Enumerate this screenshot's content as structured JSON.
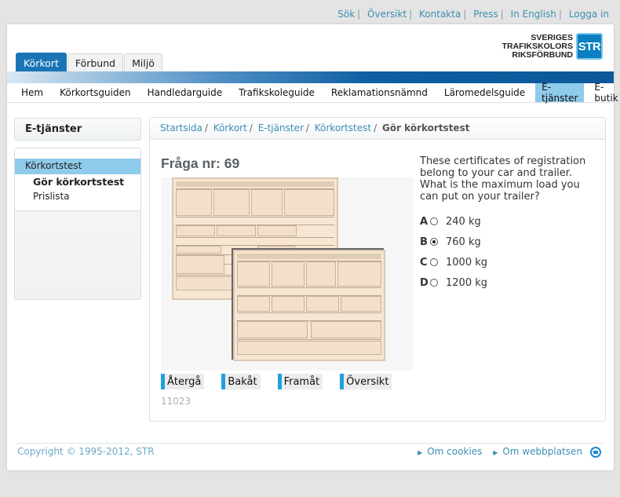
{
  "top_links": [
    "Sök",
    "Översikt",
    "Kontakta",
    "Press",
    "In English",
    "Logga in"
  ],
  "logo": {
    "line1": "SVERIGES",
    "line2": "TRAFIKSKOLORS",
    "line3": "RIKSFÖRBUND",
    "badge": "STR"
  },
  "tabs": [
    {
      "label": "Körkort",
      "active": true
    },
    {
      "label": "Förbund"
    },
    {
      "label": "Miljö"
    }
  ],
  "nav": [
    "Hem",
    "Körkortsguiden",
    "Handledarguide",
    "Trafikskoleguide",
    "Reklamationsnämnd",
    "Läromedelsguide",
    "E-tjänster",
    "E-butik"
  ],
  "nav_active": "E-tjänster",
  "sidebar": {
    "title": "E-tjänster",
    "item": "Körkortstest",
    "sub_active": "Gör körkortstest",
    "sub_other": "Prislista"
  },
  "breadcrumb": {
    "items": [
      "Startsida",
      "Körkort",
      "E-tjänster",
      "Körkortstest"
    ],
    "current": "Gör körkortstest"
  },
  "question": {
    "number_label": "Fråga nr: 69",
    "text": "These certificates of registration belong to your car and trailer. What is the maximum load you can put on your trailer?",
    "options": [
      {
        "letter": "A",
        "text": "240 kg",
        "selected": false
      },
      {
        "letter": "B",
        "text": "760 kg",
        "selected": true
      },
      {
        "letter": "C",
        "text": "1000 kg",
        "selected": false
      },
      {
        "letter": "D",
        "text": "1200 kg",
        "selected": false
      }
    ]
  },
  "buttons": {
    "back": "Återgå",
    "prev": "Bakåt",
    "next": "Framåt",
    "overview": "Översikt"
  },
  "code": "11023",
  "footer": {
    "copyright": "Copyright © 1995-2012, STR",
    "links": [
      "Om cookies",
      "Om webbplatsen"
    ]
  },
  "colors": {
    "accent": "#0d5898",
    "link": "#3a8fb0",
    "highlight": "#8fcbea",
    "button_bar": "#1ea2dd"
  }
}
